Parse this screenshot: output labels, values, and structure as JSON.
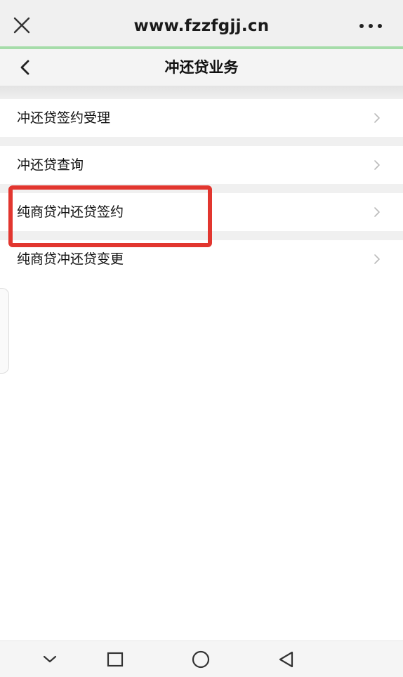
{
  "browser": {
    "url": "www.fzzfgjj.cn",
    "close_icon": "close-icon",
    "more_icon": "more-dots-icon"
  },
  "header": {
    "title": "冲还贷业务",
    "back_icon": "chevron-left-icon"
  },
  "menu": {
    "items": [
      {
        "label": "冲还贷签约受理"
      },
      {
        "label": "冲还贷查询"
      },
      {
        "label": "纯商贷冲还贷签约",
        "highlighted": true
      },
      {
        "label": "纯商贷冲还贷变更"
      }
    ],
    "chevron_icon": "chevron-right-icon"
  },
  "annotation": {
    "color": "#e2362f"
  },
  "nav": {
    "buttons": [
      "chevron-down-icon",
      "square-icon",
      "circle-icon",
      "triangle-back-icon"
    ]
  },
  "colors": {
    "loading_bar": "#a5dca9",
    "background": "#f0f0f0"
  }
}
